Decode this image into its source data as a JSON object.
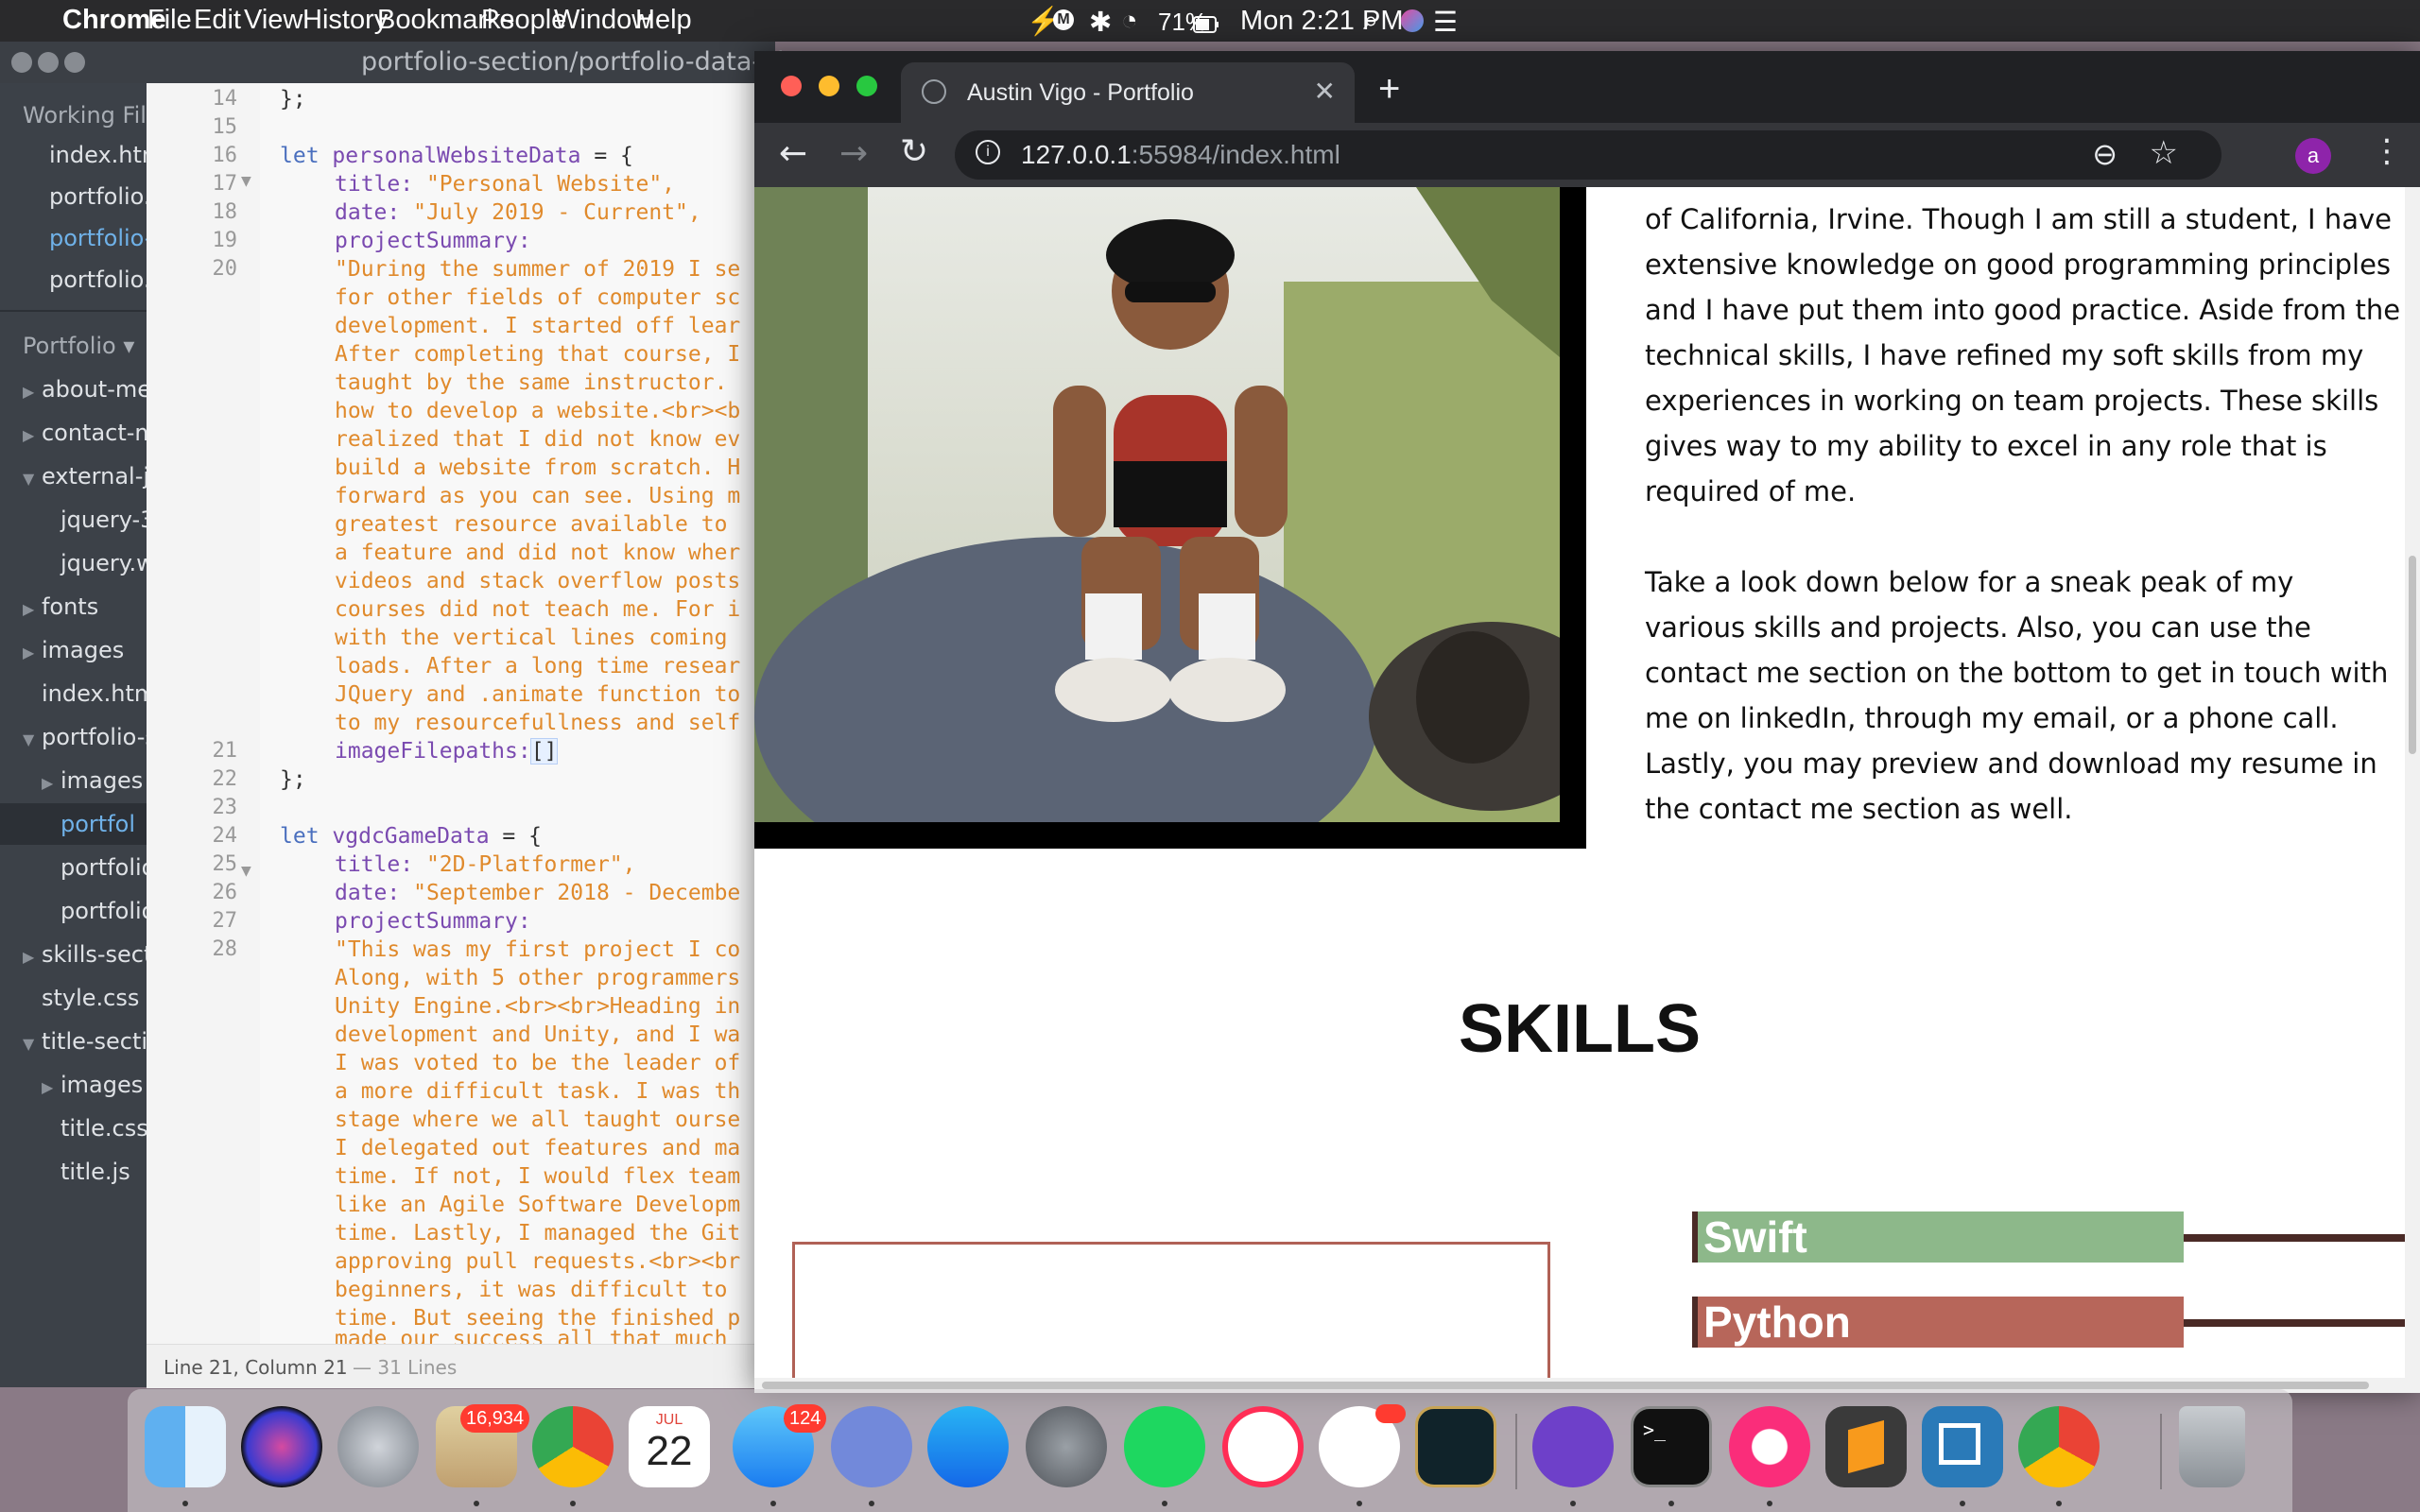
{
  "menubar": {
    "app": "Chrome",
    "items": [
      "File",
      "Edit",
      "View",
      "History",
      "Bookmarks",
      "People",
      "Window",
      "Help"
    ],
    "battery": "71%",
    "clock": "Mon 2:21 PM"
  },
  "editor": {
    "title": "portfolio-section/portfolio-data-ob",
    "working_files_label": "Working File",
    "working_files": [
      "index.htm",
      "portfolio.",
      "portfolio-",
      "portfolio."
    ],
    "project_label": "Portfolio",
    "tree": [
      "about-me",
      "contact-m",
      "external-js",
      "jquery-3",
      "jquery.w",
      "fonts",
      "images",
      "index.htm",
      "portfolio-s",
      "images",
      "portfol",
      "portfolio",
      "portfolio",
      "skills-sect",
      "style.css",
      "title-sectio",
      "images",
      "title.css",
      "title.js"
    ],
    "line_numbers": [
      "14",
      "15",
      "16",
      "17",
      "18",
      "19",
      "20",
      "21",
      "22",
      "23",
      "24",
      "25",
      "26",
      "27",
      "28"
    ],
    "code": {
      "l14": "};",
      "l16_kw": "let",
      "l16_var": "personalWebsiteData",
      "l16_rest": " = {",
      "l17_key": "title: ",
      "l17_val": "\"Personal Website\",",
      "l18_key": "date: ",
      "l18_val": "\"July 2019 - Current\",",
      "l19": "projectSummary:",
      "l20_lines": [
        "\"During the summer of 2019 I se",
        "for other fields of computer sc",
        "development. I started off lear",
        "After completing that course, I",
        "taught by the same instructor. ",
        "how to develop a website.<br><b",
        "realized that I did not know ev",
        "build a website from scratch. H",
        "forward as you can see. Using m",
        "greatest resource available to ",
        "a feature and did not know wher",
        "videos and stack overflow posts",
        "courses did not teach me. For i",
        "with the vertical lines coming ",
        "loads. After a long time resear",
        "JQuery and .animate function to",
        "to my resourcefullness and self"
      ],
      "l21_key": "imageFilepaths:",
      "l21_val": "[]",
      "l22": "};",
      "l24_kw": "let",
      "l24_var": "vgdcGameData",
      "l24_rest": " = {",
      "l25_key": "title: ",
      "l25_val": "\"2D-Platformer\",",
      "l26_key": "date: ",
      "l26_val": "\"September 2018 - Decembe",
      "l27": "projectSummary:",
      "l28_lines": [
        "\"This was my first project I co",
        "Along, with 5 other programmers",
        "Unity Engine.<br><br>Heading in",
        "development and Unity, and I wa",
        "I was voted to be the leader of",
        "a more difficult task. I was th",
        "stage where we all taught ourse",
        "I delegated out features and ma",
        "time. If not, I would flex team",
        "like an Agile Software Developm",
        "time. Lastly, I managed the Git",
        "approving pull requests.<br><br",
        "beginners, it was difficult to ",
        "time. But seeing the finished p",
        "made our success all that much "
      ]
    },
    "status": "Line 21, Column 21",
    "status_lines": "— 31 Lines"
  },
  "browser": {
    "tab_title": "Austin Vigo - Portfolio",
    "url_host": "127.0.0.1",
    "url_rest": ":55984/index.html",
    "profile_initial": "a",
    "about_paragraph_1": "of California, Irvine. Though I am still a student, I have extensive knowledge on good programming principles and I have put them into good practice. Aside from the technical skills, I have refined my soft skills from my experiences in working on team projects. These skills gives way to my ability to excel in any role that is required of me.",
    "about_paragraph_2": "Take a look down below for a sneak peak of my various skills and projects. Also, you can use the contact me section on the bottom to get in touch with me on linkedIn, through my email, or a phone call. Lastly, you may preview and download my resume in the contact me section as well.",
    "skills_title": "SKILLS",
    "skills": [
      {
        "name": "Swift",
        "color": "#8db88a"
      },
      {
        "name": "Python",
        "color": "#b7665a"
      }
    ]
  },
  "dock": {
    "mail_badge": "16,934",
    "calendar_month": "JUL",
    "calendar_day": "22",
    "messages_badge": "124"
  }
}
